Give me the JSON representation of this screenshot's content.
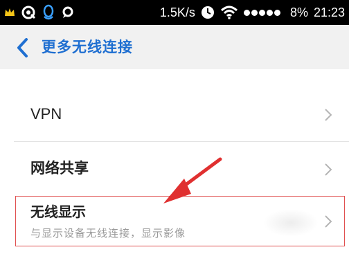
{
  "status_bar": {
    "net_speed": "1.5K/s",
    "battery": "8%",
    "time": "21:23"
  },
  "header": {
    "title": "更多无线连接"
  },
  "list": {
    "items": [
      {
        "label": "VPN"
      },
      {
        "label": "网络共享"
      },
      {
        "label": "无线显示",
        "description": "与显示设备无线连接，显示影像"
      }
    ]
  },
  "icons": {
    "back": "chevron-left-icon",
    "item_arrow": "chevron-right-icon",
    "status": [
      "crown-icon",
      "browser-icon",
      "qq-icon",
      "chat-icon",
      "clock-icon",
      "wifi-icon"
    ]
  },
  "colors": {
    "accent": "#1f6fd1",
    "annotation": "#e03030"
  }
}
